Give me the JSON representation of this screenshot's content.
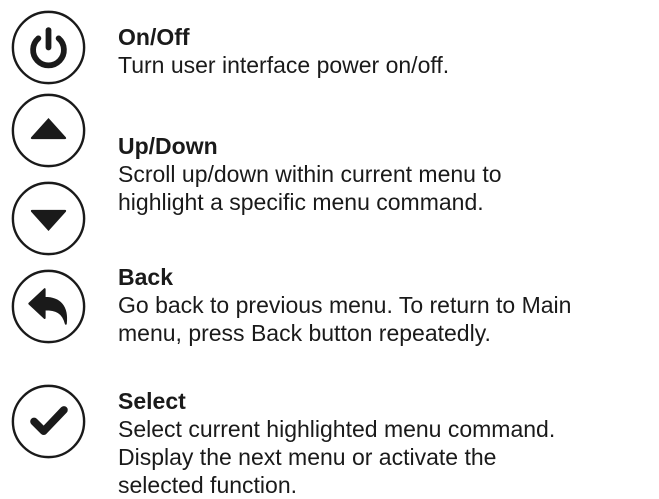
{
  "entries": [
    {
      "title": "On/Off",
      "description": "Turn user interface power on/off.",
      "icon": "power-icon"
    },
    {
      "title": "Up/Down",
      "description": "Scroll up/down within current menu to\nhighlight a specific menu command.",
      "icons": [
        "up-arrow-icon",
        "down-arrow-icon"
      ]
    },
    {
      "title": "Back",
      "description": "Go back to previous menu. To return to Main\nmenu, press Back button repeatedly.",
      "icon": "back-arrow-icon"
    },
    {
      "title": "Select",
      "description": "Select current highlighted menu command.\nDisplay the next menu or activate the\nselected function.",
      "icon": "checkmark-icon"
    }
  ],
  "colors": {
    "icon": "#1a1a1a",
    "background": "#ffffff"
  }
}
